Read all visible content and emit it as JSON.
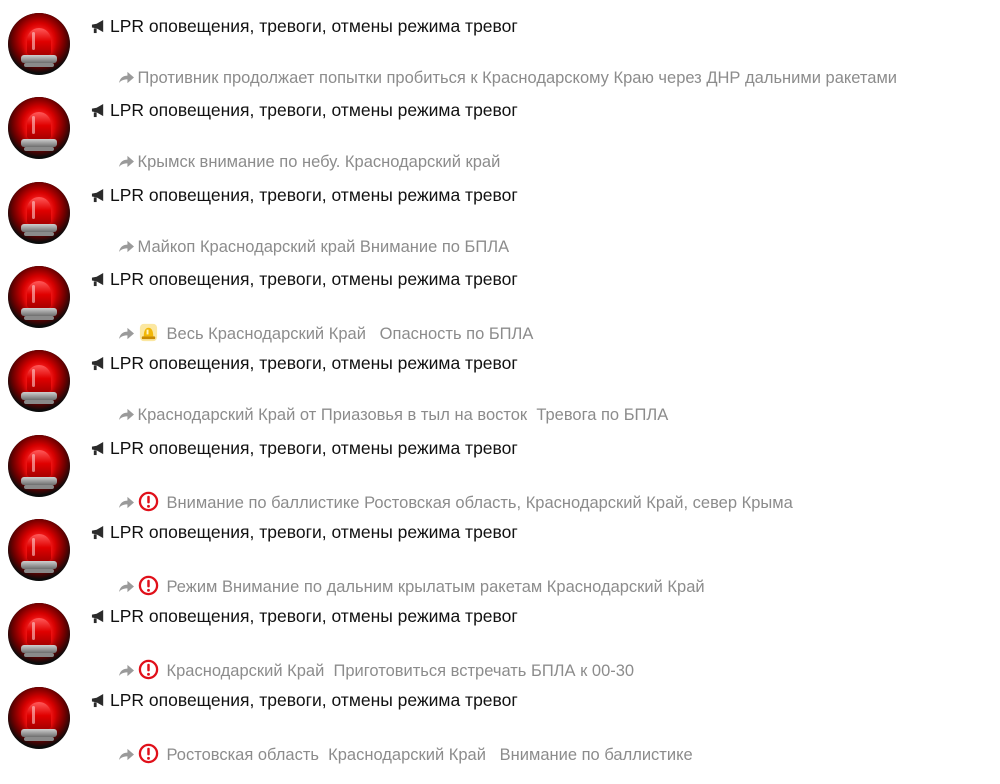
{
  "chat_list": {
    "items": [
      {
        "title": "LPR оповещения, тревоги, отмены режима тревог",
        "message": "Противник продолжает попытки пробиться к Краснодарскому Краю через ДНР дальними ракетами",
        "emoji": null
      },
      {
        "title": "LPR оповещения, тревоги, отмены режима тревог",
        "message": "Крымск внимание по небу. Краснодарский край",
        "emoji": null
      },
      {
        "title": "LPR оповещения, тревоги, отмены режима тревог",
        "message": "Майкоп Краснодарский край Внимание по БПЛА",
        "emoji": null
      },
      {
        "title": "LPR оповещения, тревоги, отмены режима тревог",
        "message": "Весь Краснодарский Край   Опасность по БПЛА",
        "emoji": "rotating-light-icon"
      },
      {
        "title": "LPR оповещения, тревоги, отмены режима тревог",
        "message": "Краснодарский Край от Приазовья в тыл на восток  Тревога по БПЛА",
        "emoji": null
      },
      {
        "title": "LPR оповещения, тревоги, отмены режима тревог",
        "message": "Внимание по баллистике Ростовская область, Краснодарский Край, север Крыма",
        "emoji": "exclamation-circle-icon"
      },
      {
        "title": "LPR оповещения, тревоги, отмены режима тревог",
        "message": "Режим Внимание по дальним крылатым ракетам Краснодарский Край",
        "emoji": "exclamation-circle-icon"
      },
      {
        "title": "LPR оповещения, тревоги, отмены режима тревог",
        "message": "Краснодарский Край  Приготовиться встречать БПЛА к 00-30",
        "emoji": "exclamation-circle-icon"
      },
      {
        "title": "LPR оповещения, тревоги, отмены режима тревог",
        "message": "Ростовская область  Краснодарский Край   Внимание по баллистике",
        "emoji": "exclamation-circle-icon"
      }
    ]
  },
  "icons": {
    "title_prefix": "megaphone-icon",
    "message_prefix": "forward-arrow-icon",
    "avatar": "red-alarm-light-avatar"
  },
  "colors": {
    "title": "#111111",
    "message": "#8c8c8c",
    "alert_red": "#e0101a",
    "siren_yellow": "#f2b705"
  }
}
